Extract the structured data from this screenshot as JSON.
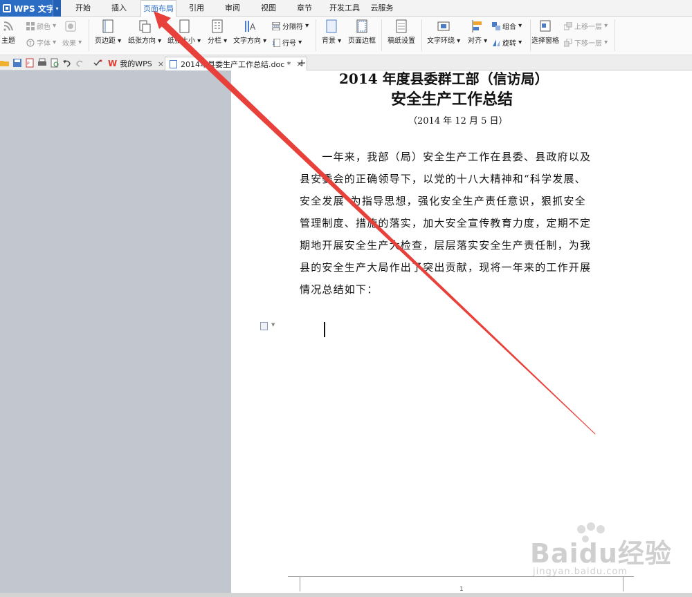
{
  "app": {
    "name": "WPS 文字",
    "caret": "▾"
  },
  "menu": {
    "tabs": [
      {
        "label": "开始"
      },
      {
        "label": "插入"
      },
      {
        "label": "页面布局"
      },
      {
        "label": "引用"
      },
      {
        "label": "审阅"
      },
      {
        "label": "视图"
      },
      {
        "label": "章节"
      },
      {
        "label": "开发工具"
      },
      {
        "label": "云服务"
      }
    ],
    "active_tab": "页面布局"
  },
  "ribbon": {
    "theme": "主题",
    "color": "颜色",
    "font": "字体",
    "effect": "效果",
    "margins": "页边距",
    "orientation": "纸张方向",
    "size": "纸张大小",
    "columns": "分栏",
    "text_direction": "文字方向",
    "breaks": "分隔符",
    "line_numbers": "行号",
    "background": "背景",
    "page_border": "页面边框",
    "manuscript": "稿纸设置",
    "wrap_text": "文字环绕",
    "align": "对齐",
    "group": "组合",
    "rotate": "旋转",
    "selection_pane": "选择窗格",
    "bring_forward": "上移一层",
    "send_backward": "下移一层"
  },
  "doc_tabs": {
    "tabs": [
      {
        "label": "我的WPS",
        "close": "×"
      },
      {
        "label": "2014年县委生产工作总结.doc *",
        "close": "×"
      }
    ],
    "new_tab": "+"
  },
  "document": {
    "title_line1": "2014 年度县委群工部（信访局）",
    "title_line2": "安全生产工作总结",
    "date": "（2014 年 12 月 5 日）",
    "body_lines": [
      "　　一年来，我部（局）安全生产工作在县委、县政府以及",
      "县安委会的正确领导下，以党的十八大精神和“科学发展、",
      "安全发展”为指导思想，强化安全生产责任意识，狠抓安全",
      "管理制度、措施的落实，加大安全宣传教育力度，定期不定",
      "期地开展安全生产大检查，层层落实安全生产责任制，为我",
      "县的安全生产大局作出了突出贡献，现将一年来的工作开展",
      "情况总结如下："
    ],
    "page_number": "1"
  },
  "watermark": {
    "text": "Baidu经验",
    "sub": "jingyan.baidu.com"
  },
  "colors": {
    "accent": "#2b6cc4",
    "arrow": "#e8403a",
    "sidebar": "#c2c6cf"
  }
}
